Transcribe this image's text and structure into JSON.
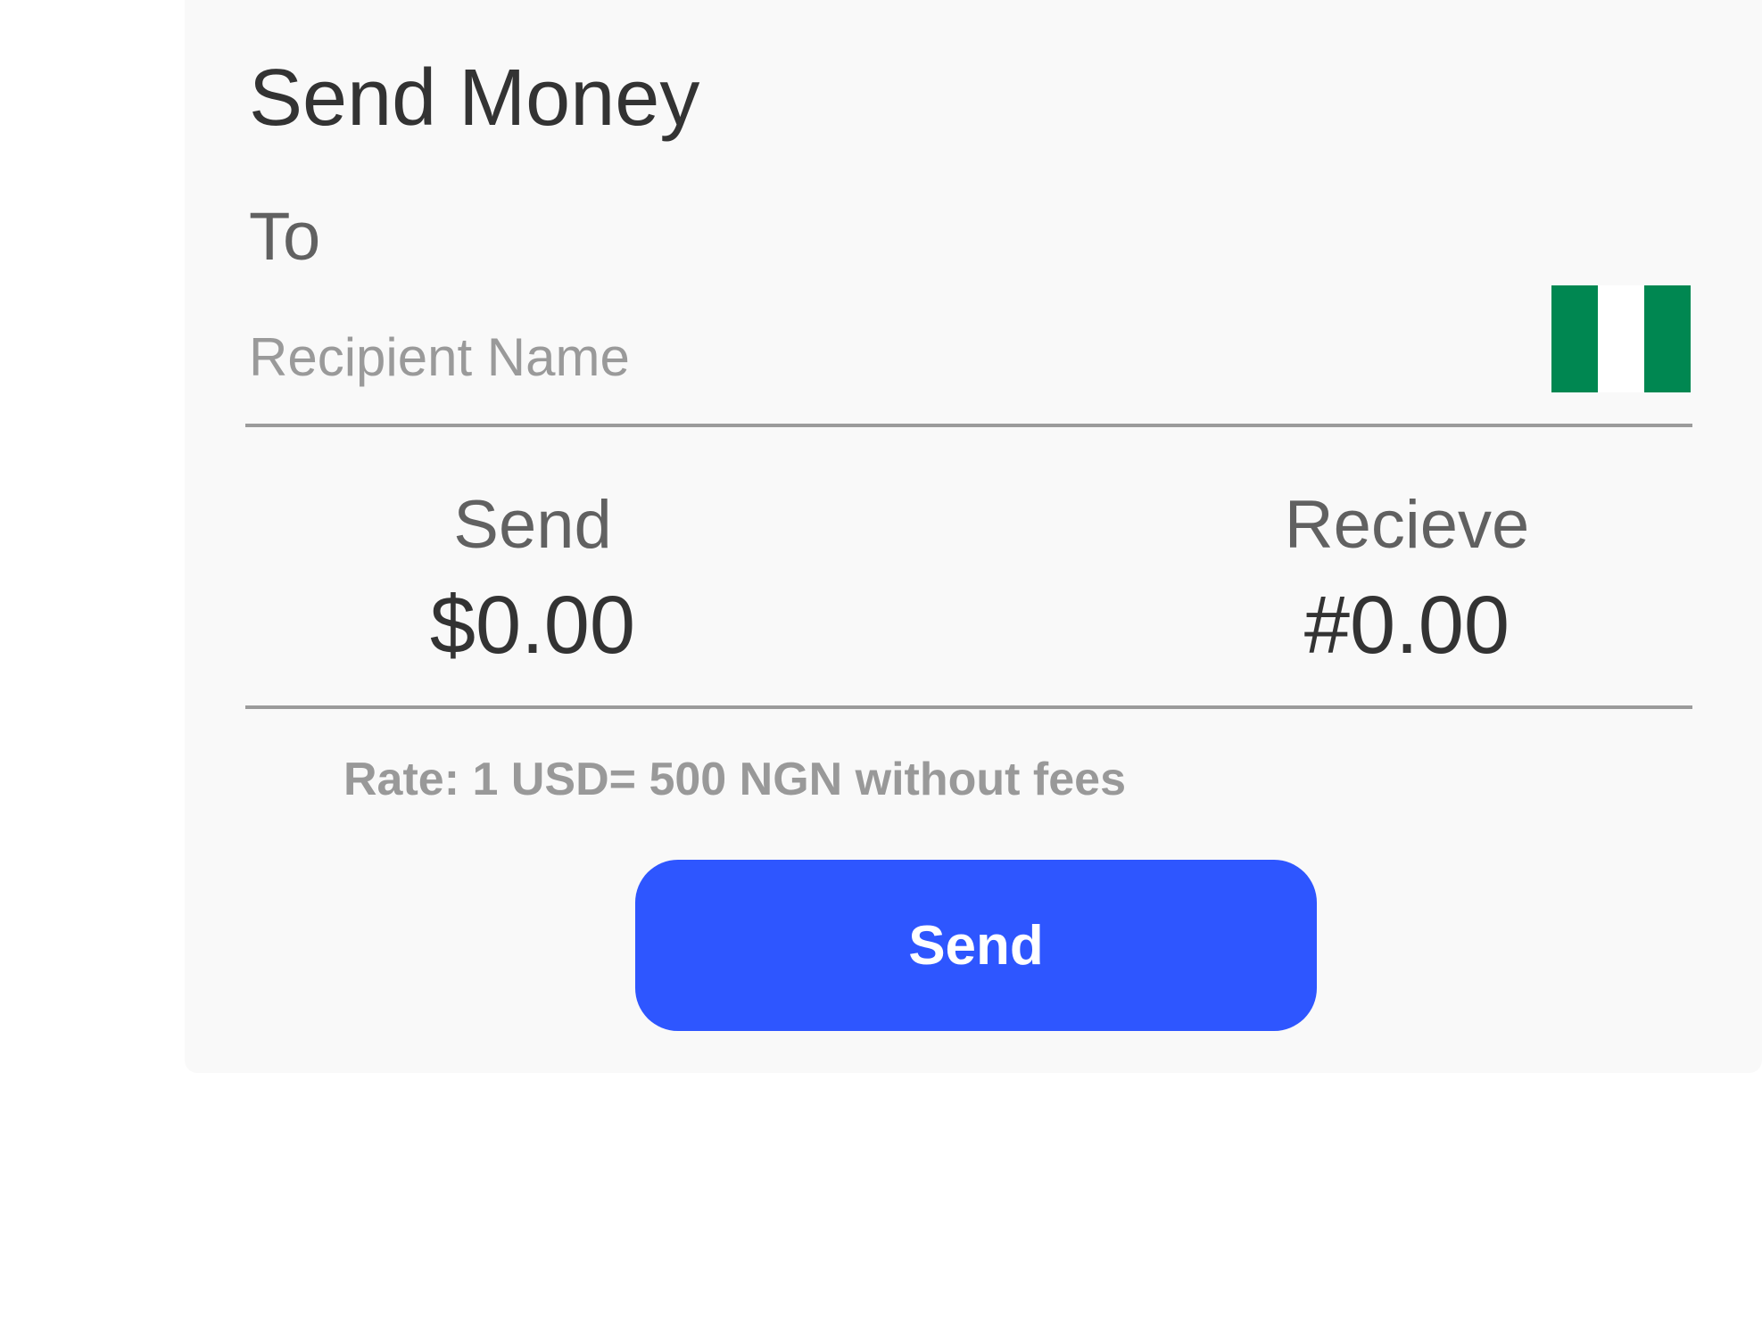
{
  "header": {
    "title": "Send Money"
  },
  "recipient": {
    "to_label": "To",
    "name_value": "",
    "name_placeholder": "Recipient Name",
    "country_flag": {
      "icon": "nigeria-flag-icon",
      "colors": [
        "#008751",
        "#ffffff",
        "#008751"
      ]
    }
  },
  "amounts": {
    "send_label": "Send",
    "send_value": "$0.00",
    "receive_label": "Recieve",
    "receive_value": "#0.00"
  },
  "rate_text": "Rate: 1 USD= 500 NGN without fees",
  "actions": {
    "send_button_label": "Send",
    "send_button_color": "#2e56ff"
  }
}
